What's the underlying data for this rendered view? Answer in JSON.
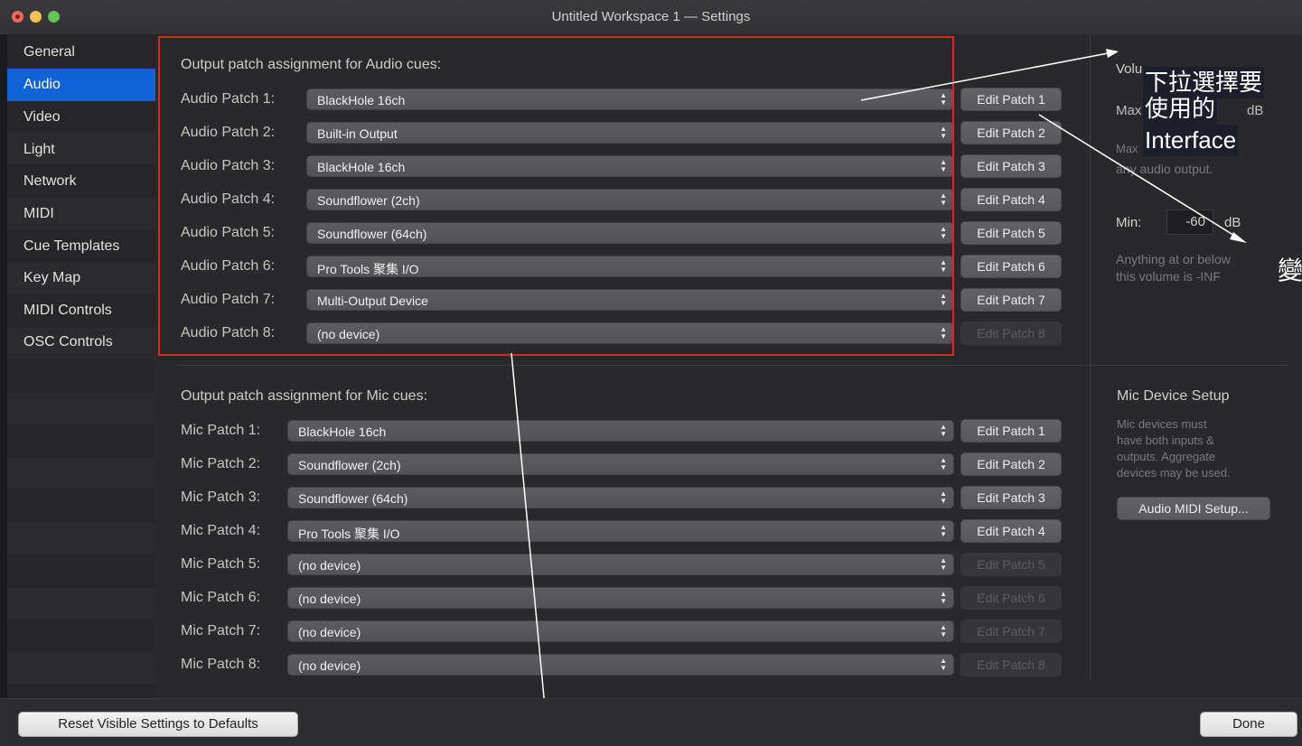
{
  "window": {
    "title": "Untitled Workspace 1 — Settings"
  },
  "sidebar": {
    "items": [
      "General",
      "Audio",
      "Video",
      "Light",
      "Network",
      "MIDI",
      "Cue Templates",
      "Key Map",
      "MIDI Controls",
      "OSC Controls"
    ],
    "active_index": 1
  },
  "audio": {
    "section_title": "Output patch assignment for Audio cues:",
    "patches": [
      {
        "label": "Audio Patch 1:",
        "device": "BlackHole 16ch",
        "button": "Edit Patch 1",
        "enabled": true
      },
      {
        "label": "Audio Patch 2:",
        "device": "Built-in Output",
        "button": "Edit Patch 2",
        "enabled": true
      },
      {
        "label": "Audio Patch 3:",
        "device": "BlackHole 16ch",
        "button": "Edit Patch 3",
        "enabled": true
      },
      {
        "label": "Audio Patch 4:",
        "device": "Soundflower (2ch)",
        "button": "Edit Patch 4",
        "enabled": true
      },
      {
        "label": "Audio Patch 5:",
        "device": "Soundflower (64ch)",
        "button": "Edit Patch 5",
        "enabled": true
      },
      {
        "label": "Audio Patch 6:",
        "device": "Pro Tools 聚集 I/O",
        "button": "Edit Patch 6",
        "enabled": true
      },
      {
        "label": "Audio Patch 7:",
        "device": "Multi-Output Device",
        "button": "Edit Patch 7",
        "enabled": true
      },
      {
        "label": "Audio Patch 8:",
        "device": "(no device)",
        "button": "Edit Patch 8",
        "enabled": false
      }
    ]
  },
  "mic": {
    "section_title": "Output patch assignment for Mic cues:",
    "patches": [
      {
        "label": "Mic Patch 1:",
        "device": "BlackHole 16ch",
        "button": "Edit Patch 1",
        "enabled": true
      },
      {
        "label": "Mic Patch 2:",
        "device": "Soundflower (2ch)",
        "button": "Edit Patch 2",
        "enabled": true
      },
      {
        "label": "Mic Patch 3:",
        "device": "Soundflower (64ch)",
        "button": "Edit Patch 3",
        "enabled": true
      },
      {
        "label": "Mic Patch 4:",
        "device": "Pro Tools 聚集 I/O",
        "button": "Edit Patch 4",
        "enabled": true
      },
      {
        "label": "Mic Patch 5:",
        "device": "(no device)",
        "button": "Edit Patch 5",
        "enabled": false
      },
      {
        "label": "Mic Patch 6:",
        "device": "(no device)",
        "button": "Edit Patch 6",
        "enabled": false
      },
      {
        "label": "Mic Patch 7:",
        "device": "(no device)",
        "button": "Edit Patch 7",
        "enabled": false
      },
      {
        "label": "Mic Patch 8:",
        "device": "(no device)",
        "button": "Edit Patch 8",
        "enabled": false
      }
    ]
  },
  "volume_panel": {
    "title_partial": "Volu",
    "max_label_partial": "Max",
    "max_unit": "dB",
    "max_desc_partial": "Max",
    "max_desc_line2": "any audio output.",
    "min_label": "Min:",
    "min_value": "-60",
    "min_unit": "dB",
    "min_desc": [
      "Anything at or below",
      "this volume is -INF"
    ]
  },
  "mic_setup": {
    "title": "Mic Device Setup",
    "desc": [
      "Mic devices must",
      "have both inputs &",
      "outputs. Aggregate",
      "devices may be used."
    ],
    "button": "Audio MIDI Setup..."
  },
  "annotations": {
    "note_lines": [
      "下拉選擇要",
      "使用的",
      "Interface"
    ],
    "side_char": "變"
  },
  "footer": {
    "reset_button": "Reset Visible Settings to Defaults",
    "done_button": "Done"
  },
  "colors": {
    "accent": "#0f63d6",
    "annotation_box": "#e02424",
    "bg": "#29292b"
  }
}
